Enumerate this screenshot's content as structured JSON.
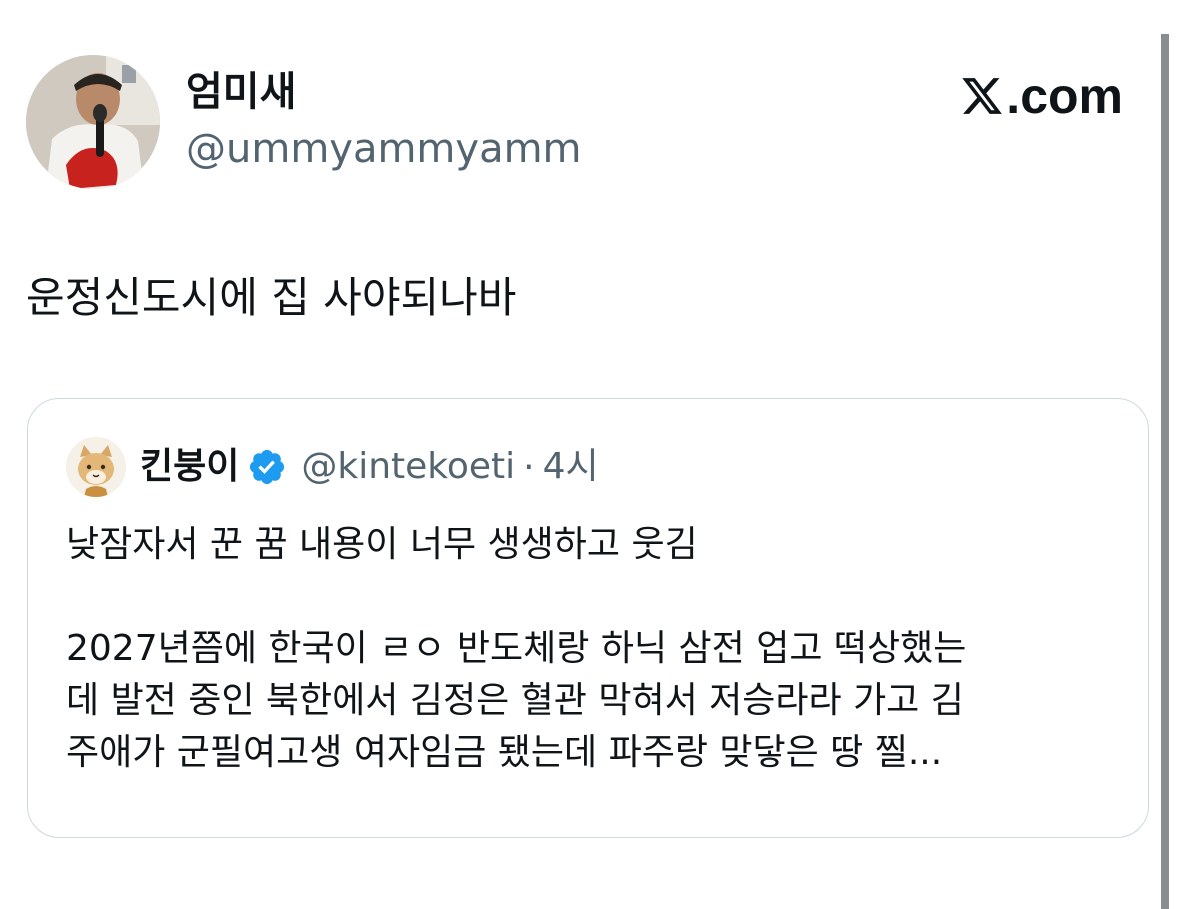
{
  "author": {
    "display_name": "엄미새",
    "handle": "@ummyammyamm",
    "avatar_icon": "profile-photo"
  },
  "brand": {
    "icon": "x-logo-icon",
    "text": ".com"
  },
  "tweet": {
    "text": "운정신도시에 집 사야되나바"
  },
  "quote": {
    "display_name": "킨붕이",
    "verified_icon": "verified-badge-icon",
    "verified_color": "#1d9bf0",
    "handle": "@kintekoeti",
    "separator": "·",
    "time": "4시",
    "lines": [
      "낮잠자서 꾼 꿈 내용이 너무 생생하고 웃김",
      "",
      "2027년쯤에 한국이 ㄹㅇ 반도체랑 하닉 삼전 업고 떡상했는",
      "데 발전 중인 북한에서 김정은 혈관 막혀서 저승라라 가고 김",
      "주애가 군필여고생 여자임금 됐는데 파주랑 맞닿은 땅 찔..."
    ]
  }
}
